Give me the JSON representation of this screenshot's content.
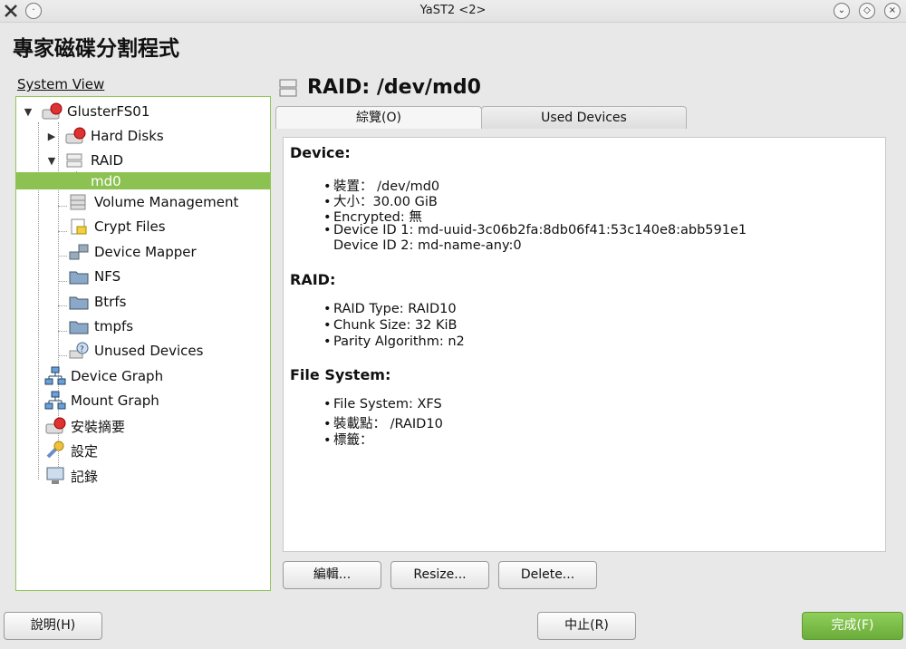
{
  "window": {
    "title": "YaST2 <2>"
  },
  "app": {
    "title": "專家磁碟分割程式"
  },
  "sidebar": {
    "label": "System View",
    "items": [
      {
        "label": "GlusterFS01"
      },
      {
        "label": "Hard Disks"
      },
      {
        "label": "RAID"
      },
      {
        "label": "md0"
      },
      {
        "label": "Volume Management"
      },
      {
        "label": "Crypt Files"
      },
      {
        "label": "Device Mapper"
      },
      {
        "label": "NFS"
      },
      {
        "label": "Btrfs"
      },
      {
        "label": "tmpfs"
      },
      {
        "label": "Unused Devices"
      },
      {
        "label": "Device Graph"
      },
      {
        "label": "Mount Graph"
      },
      {
        "label": "安裝摘要"
      },
      {
        "label": "設定"
      },
      {
        "label": "記錄"
      }
    ]
  },
  "main": {
    "heading": "RAID: /dev/md0",
    "tabs": [
      {
        "label": "綜覽(O)"
      },
      {
        "label": "Used Devices"
      }
    ],
    "sections": {
      "device": {
        "title": "Device:",
        "items": [
          "裝置： /dev/md0",
          "大小：30.00 GiB",
          "Encrypted: 無",
          "Device ID 1: md-uuid-3c06b2fa:8db06f41:53c140e8:abb591e1",
          "Device ID 2: md-name-any:0"
        ]
      },
      "raid": {
        "title": "RAID:",
        "items": [
          "RAID Type: RAID10",
          "Chunk Size: 32 KiB",
          "Parity Algorithm: n2"
        ]
      },
      "filesystem": {
        "title": "File System:",
        "items": [
          "File System: XFS",
          "裝載點： /RAID10",
          "標籤："
        ]
      }
    },
    "buttons": {
      "edit": "編輯...",
      "resize": "Resize...",
      "delete": "Delete..."
    }
  },
  "footer": {
    "help": "說明(H)",
    "abort": "中止(R)",
    "finish": "完成(F)"
  },
  "colors": {
    "accent": "#8cc251",
    "finish": "#6aac3a"
  }
}
